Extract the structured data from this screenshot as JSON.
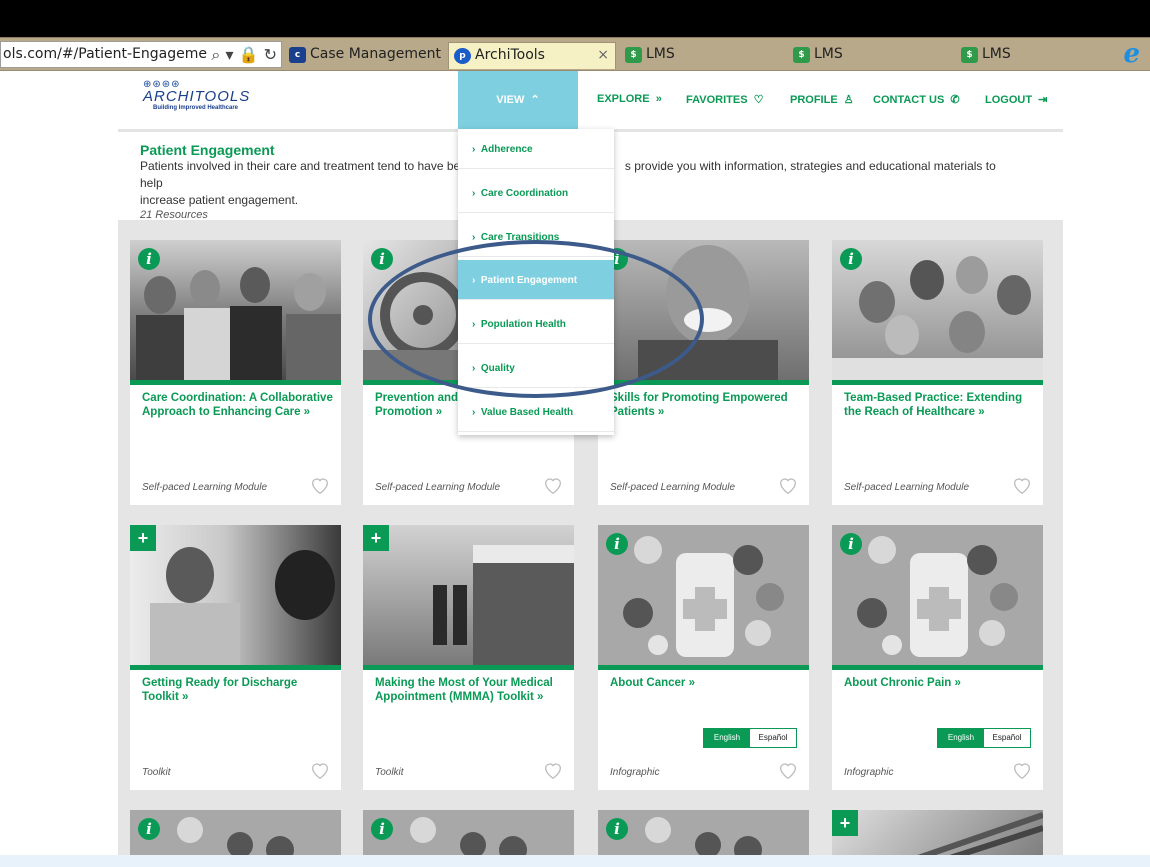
{
  "browser": {
    "url": "ols.com/#/Patient-Engageme",
    "tabs": [
      {
        "label": "Case Management S..."
      },
      {
        "label": "ArchiTools"
      },
      {
        "label": "LMS"
      },
      {
        "label": "LMS"
      },
      {
        "label": "LMS"
      }
    ],
    "close_glyph": "×"
  },
  "logo": {
    "name": "ARCHITOOLS",
    "tagline": "Building Improved Healthcare"
  },
  "nav": {
    "view": "VIEW",
    "explore": "EXPLORE",
    "favorites": "FAVORITES",
    "profile": "PROFILE",
    "contact": "CONTACT US",
    "logout": "LOGOUT"
  },
  "intro": {
    "title": "Patient Engagement",
    "text_a": "Patients involved in their care and treatment tend to have be",
    "text_b": "s provide you with information, strategies and educational materials to help",
    "text_c": "increase patient engagement.",
    "count": "21 Resources"
  },
  "dropdown": [
    {
      "label": "Adherence"
    },
    {
      "label": "Care Coordination"
    },
    {
      "label": "Care Transitions"
    },
    {
      "label": "Patient Engagement"
    },
    {
      "label": "Population Health"
    },
    {
      "label": "Quality"
    },
    {
      "label": "Value Based Health"
    }
  ],
  "cards": [
    {
      "title": "Care Coordination: A Collaborative Approach to Enhancing Care »",
      "type": "Self-paced Learning Module",
      "badge": "i"
    },
    {
      "title": "Prevention and the Curve Throu Promotion »",
      "type": "Self-paced Learning Module",
      "badge": "i"
    },
    {
      "title": "Skills for Promoting Empowered Patients »",
      "type": "Self-paced Learning Module",
      "badge": "i"
    },
    {
      "title": "Team-Based Practice: Extending the Reach of Healthcare »",
      "type": "Self-paced Learning Module",
      "badge": "i"
    },
    {
      "title": "Getting Ready for Discharge Toolkit »",
      "type": "Toolkit",
      "badge": "+"
    },
    {
      "title": "Making the Most of Your Medical Appointment (MMMA) Toolkit »",
      "type": "Toolkit",
      "badge": "+"
    },
    {
      "title": "About Cancer »",
      "type": "Infographic",
      "badge": "i",
      "lang": [
        "English",
        "Español"
      ]
    },
    {
      "title": "About Chronic Pain »",
      "type": "Infographic",
      "badge": "i",
      "lang": [
        "English",
        "Español"
      ]
    }
  ],
  "colors": {
    "accent": "#0a9a55",
    "nav_active": "#7ed0e0",
    "annotation": "#3c5b8a"
  }
}
